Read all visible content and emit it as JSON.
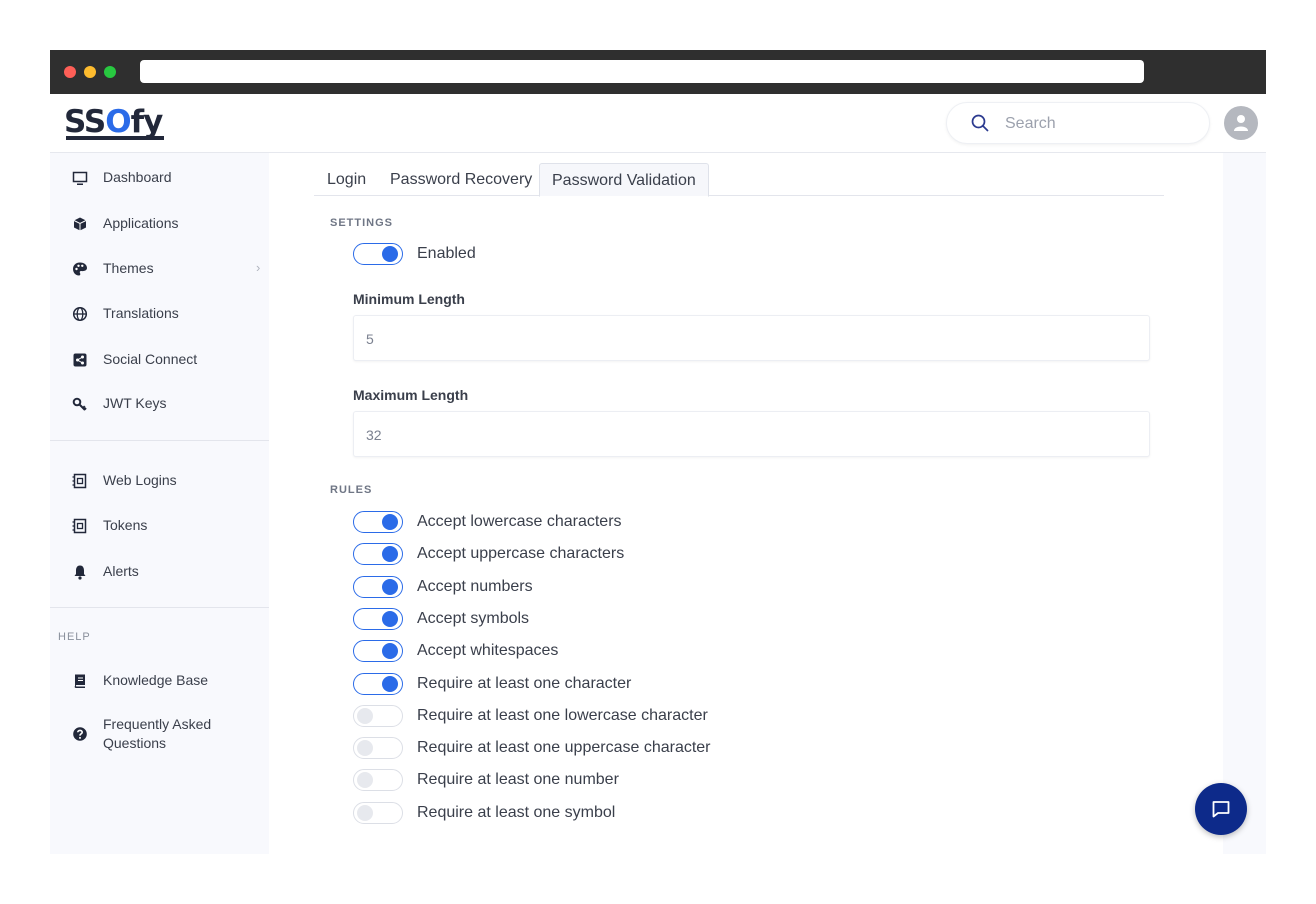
{
  "brand": {
    "logo_prefix": "SS",
    "logo_o": "O",
    "logo_suffix": "fy"
  },
  "search": {
    "placeholder": "Search"
  },
  "sidebar": {
    "items": [
      {
        "label": "Dashboard",
        "icon": "monitor-icon"
      },
      {
        "label": "Applications",
        "icon": "cube-icon"
      },
      {
        "label": "Themes",
        "icon": "palette-icon",
        "has_submenu": true
      },
      {
        "label": "Translations",
        "icon": "globe-icon"
      },
      {
        "label": "Social Connect",
        "icon": "share-icon"
      },
      {
        "label": "JWT Keys",
        "icon": "key-icon"
      },
      {
        "label": "Web Logins",
        "icon": "list-icon"
      },
      {
        "label": "Tokens",
        "icon": "list-icon"
      },
      {
        "label": "Alerts",
        "icon": "bell-icon"
      }
    ],
    "help_label": "HELP",
    "help_items": [
      {
        "label": "Knowledge Base",
        "icon": "book-icon"
      },
      {
        "label": "Frequently Asked Questions",
        "line1": "Frequently Asked",
        "line2": "Questions",
        "icon": "question-circle-icon"
      }
    ]
  },
  "tabs": [
    {
      "label": "Login",
      "active": false
    },
    {
      "label": "Password Recovery",
      "active": false
    },
    {
      "label": "Password Validation",
      "active": true
    }
  ],
  "settings": {
    "label": "SETTINGS",
    "enabled_label": "Enabled",
    "enabled": true,
    "min_length_label": "Minimum Length",
    "min_length_value": "5",
    "max_length_label": "Maximum Length",
    "max_length_value": "32"
  },
  "rules": {
    "label": "RULES",
    "items": [
      {
        "label": "Accept lowercase characters",
        "on": true
      },
      {
        "label": "Accept uppercase characters",
        "on": true
      },
      {
        "label": "Accept numbers",
        "on": true
      },
      {
        "label": "Accept symbols",
        "on": true
      },
      {
        "label": "Accept whitespaces",
        "on": true
      },
      {
        "label": "Require at least one character",
        "on": true
      },
      {
        "label": "Require at least one lowercase character",
        "on": false
      },
      {
        "label": "Require at least one uppercase character",
        "on": false
      },
      {
        "label": "Require at least one number",
        "on": false
      },
      {
        "label": "Require at least one symbol",
        "on": false
      }
    ]
  },
  "colors": {
    "accent": "#2b6be8",
    "chat_button": "#0d2a8a",
    "sidebar_bg": "#f8f9fd"
  }
}
